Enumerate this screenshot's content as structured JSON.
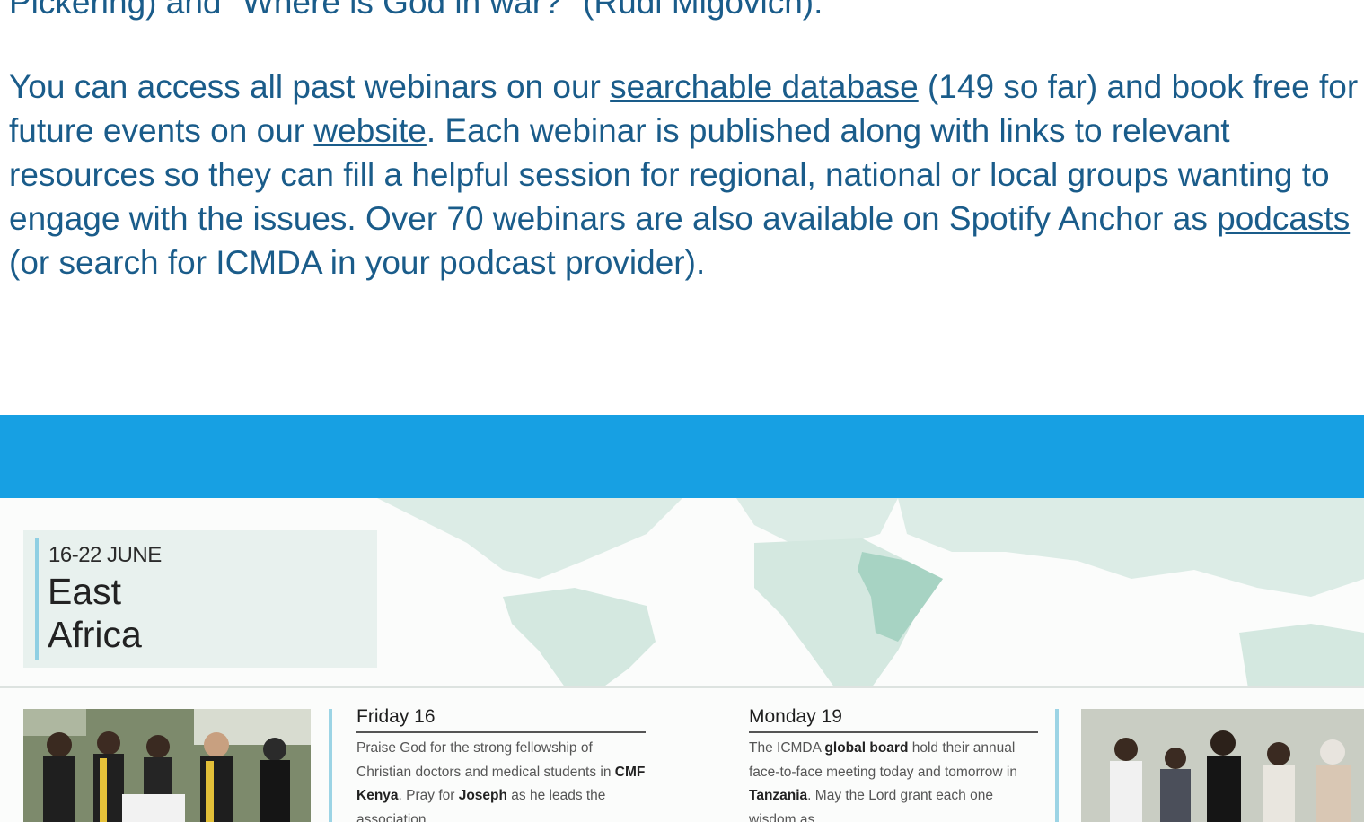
{
  "text": {
    "top_line": "Pickering) and \"Where is God in war?\" (Rudi Migovich).",
    "p1": "You can access all past webinars on our ",
    "link_database": "searchable database",
    "p2": " (149 so far) and book free for future events on our ",
    "link_website": "website",
    "p3": ". Each webinar is published along with links to relevant resources so they can fill a helpful session for regional, national or local groups wanting to engage with the issues. Over 70 webinars are also available on Spotify Anchor as ",
    "link_podcasts": "podcasts",
    "p4": " (or search for ICMDA in your podcast provider)."
  },
  "colors": {
    "text": "#1a5c8a",
    "band": "#17a0e3",
    "map": "#cfe6de",
    "map_highlight": "#a7d3c3"
  },
  "flyer": {
    "dates": "16-22 JUNE",
    "region_line1": "East",
    "region_line2": "Africa",
    "day1": {
      "title": "Friday 16",
      "t1": "Praise God for the strong fellowship of Christian doctors and medical students in ",
      "b1": "CMF Kenya",
      "t2": ". Pray for ",
      "b2": "Joseph",
      "t3": " as he leads the association"
    },
    "day2": {
      "title": "Monday 19",
      "t1": "The ICMDA ",
      "b1": "global board",
      "t2": " hold their annual face-to-face meeting today and tomorrow in ",
      "b2": "Tanzania",
      "t3": ". May the Lord grant each one wisdom as"
    }
  }
}
